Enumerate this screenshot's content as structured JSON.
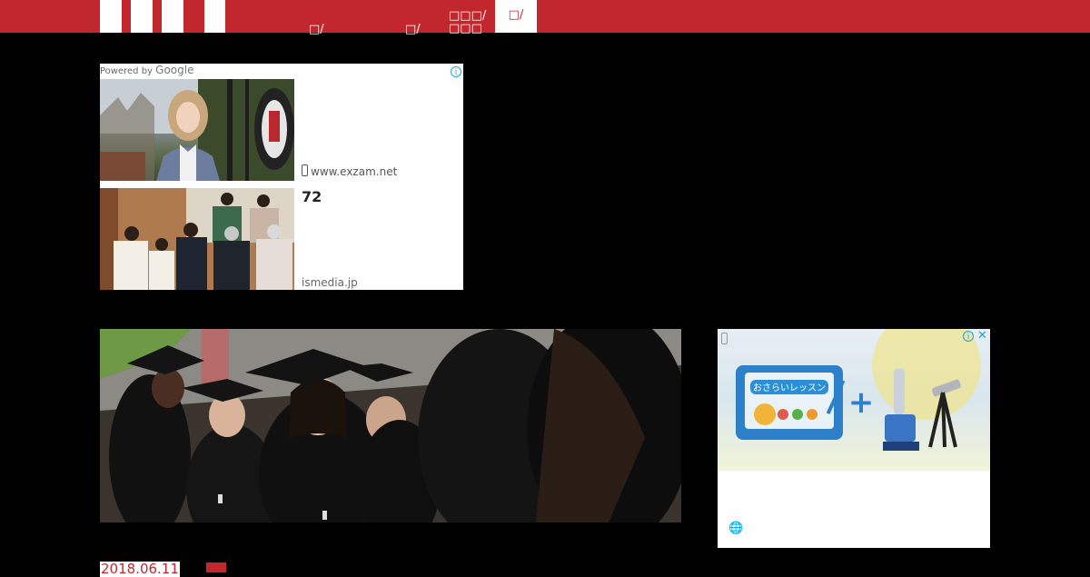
{
  "header": {
    "nav": [
      {
        "label": "□/"
      },
      {
        "label": "□/"
      },
      {
        "label": "□□□/",
        "sub": "□□□"
      }
    ],
    "active_nav": {
      "label": "□/"
    }
  },
  "ad_top": {
    "powered_by": "Powered by",
    "brand": "Google",
    "url": "www.exzam.net",
    "headline": "72",
    "source": "ismedia.jp"
  },
  "ad_side": {
    "banner_title": "おさらいレッスン",
    "plus": "+"
  },
  "post": {
    "date": "2018.06.11"
  },
  "colors": {
    "brand_red": "#c1272d",
    "ad_choices_blue": "#1fa3d6"
  }
}
